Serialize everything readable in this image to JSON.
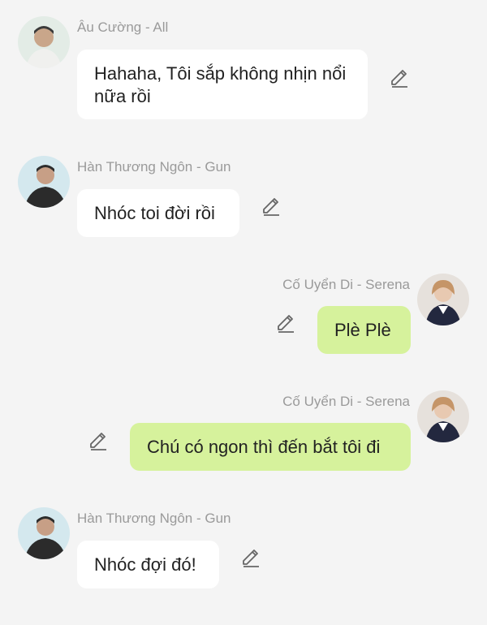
{
  "messages": [
    {
      "sender": "Âu Cường - All",
      "text": "Hahaha, Tôi sắp không nhịn nổi nữa rồi",
      "side": "left"
    },
    {
      "sender": "Hàn Thương Ngôn - Gun",
      "text": "Nhóc toi đời rồi",
      "side": "left"
    },
    {
      "sender": "Cố Uyển Di - Serena",
      "text": "Plè Plè",
      "side": "right"
    },
    {
      "sender": "Cố Uyển Di - Serena",
      "text": "Chú có ngon thì đến bắt tôi đi",
      "side": "right"
    },
    {
      "sender": "Hàn Thương Ngôn - Gun",
      "text": "Nhóc đợi đó!",
      "side": "left"
    }
  ],
  "icons": {
    "edit": "pencil-edit-icon",
    "avatar": "avatar"
  },
  "colors": {
    "background": "#f4f4f4",
    "bubble_left": "#ffffff",
    "bubble_right": "#d6f29c",
    "name_text": "#9a9a9a"
  }
}
